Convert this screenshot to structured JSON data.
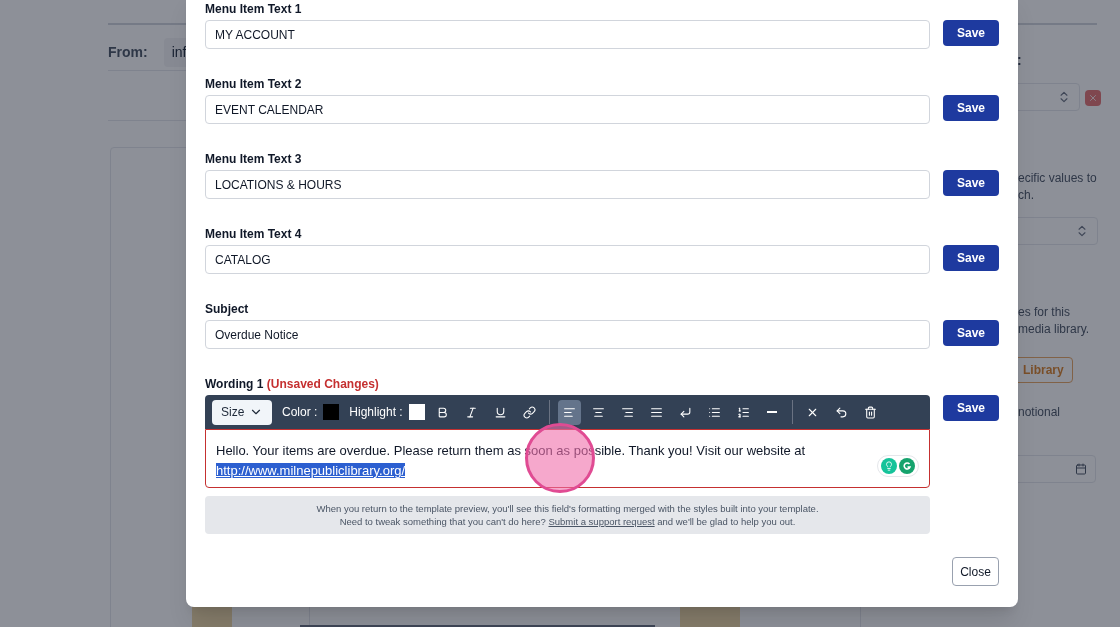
{
  "background": {
    "from_label": "From:",
    "from_value": "inf",
    "right_colon": ":",
    "right_texts": [
      "ecific values to",
      "ch.",
      "es for this",
      "media library.",
      "notional"
    ],
    "library_button": "Library"
  },
  "fields": [
    {
      "label": "Menu Item Text 1",
      "value": "MY ACCOUNT",
      "save": "Save"
    },
    {
      "label": "Menu Item Text 2",
      "value": "EVENT CALENDAR",
      "save": "Save"
    },
    {
      "label": "Menu Item Text 3",
      "value": "LOCATIONS & HOURS",
      "save": "Save"
    },
    {
      "label": "Menu Item Text 4",
      "value": "CATALOG",
      "save": "Save"
    },
    {
      "label": "Subject",
      "value": "Overdue Notice",
      "save": "Save"
    }
  ],
  "wording": {
    "label": "Wording 1",
    "status": "(Unsaved Changes)",
    "save": "Save",
    "toolbar": {
      "size": "Size",
      "swatches": [
        {
          "label": "Color :",
          "color": "#000000"
        },
        {
          "label": "Highlight :",
          "color": "#ffffff"
        }
      ],
      "buttons": [
        {
          "kind": "bold",
          "selected": false
        },
        {
          "kind": "italic",
          "selected": false
        },
        {
          "kind": "underline",
          "selected": false
        },
        {
          "kind": "link",
          "selected": false
        },
        {
          "kind": "separator"
        },
        {
          "kind": "align-left",
          "selected": true
        },
        {
          "kind": "align-center",
          "selected": false
        },
        {
          "kind": "align-right",
          "selected": false
        },
        {
          "kind": "justify",
          "selected": false
        },
        {
          "kind": "line-break",
          "selected": false
        },
        {
          "kind": "bullet-list",
          "selected": false
        },
        {
          "kind": "ordered-list",
          "selected": false
        },
        {
          "kind": "rule",
          "selected": false
        },
        {
          "kind": "separator"
        },
        {
          "kind": "clear",
          "selected": false
        },
        {
          "kind": "undo",
          "selected": false
        },
        {
          "kind": "delete",
          "selected": false
        }
      ]
    },
    "text": "Hello. Your items are overdue. Please return them as soon as possible. Thank you! Visit our website at",
    "link": {
      "text": "http://www.milnepubliclibrary.org/",
      "selected": true
    }
  },
  "note": {
    "line1": "When you return to the template preview, you'll see this field's formatting merged with the styles built into your template.",
    "line2_before": "Need to tweak something that you can't do here?",
    "link": "Submit a support request",
    "line2_after": "and we'll be glad to help you out."
  },
  "close": "Close"
}
